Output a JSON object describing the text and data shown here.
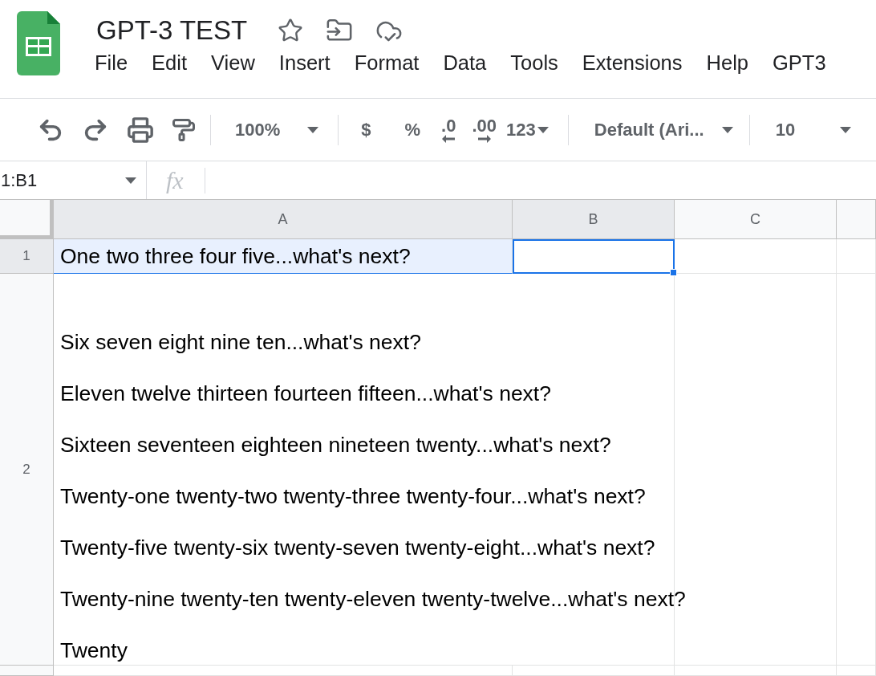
{
  "document": {
    "title": "GPT-3 TEST",
    "menu": [
      "File",
      "Edit",
      "View",
      "Insert",
      "Format",
      "Data",
      "Tools",
      "Extensions",
      "Help",
      "GPT3"
    ]
  },
  "toolbar": {
    "zoom": "100%",
    "currency": "$",
    "percent": "%",
    "decrease_decimal": ".0",
    "increase_decimal": ".00",
    "number_format": "123",
    "font": "Default (Ari...",
    "font_size": "10"
  },
  "formula_bar": {
    "name_box": "1:B1",
    "function_label": "fx"
  },
  "sheet": {
    "columns": [
      {
        "label": "A",
        "selected": true
      },
      {
        "label": "B",
        "selected": true
      },
      {
        "label": "C",
        "selected": false
      },
      {
        "selected": false
      }
    ],
    "rows": [
      {
        "number": "1",
        "selected": true,
        "cells": [
          {
            "lines": [
              "One two three four five...what's next?"
            ],
            "selected": true,
            "active": false
          },
          {
            "selected": true,
            "active": true
          },
          {
            "selected": false,
            "active": false
          },
          {
            "selected": false,
            "active": false
          }
        ]
      },
      {
        "number": "2",
        "selected": false,
        "cells": [
          {
            "lines": [
              "Six seven eight nine ten...what's next?",
              "Eleven twelve thirteen fourteen fifteen...what's next?",
              "Sixteen seventeen eighteen nineteen twenty...what's next?",
              "Twenty-one twenty-two twenty-three twenty-four...what's next?",
              "Twenty-five twenty-six twenty-seven twenty-eight...what's next?",
              "Twenty-nine twenty-ten twenty-eleven twenty-twelve...what's next?",
              "Twenty"
            ],
            "selected": false,
            "active": false
          },
          {
            "selected": false,
            "active": false
          },
          {
            "selected": false,
            "active": false
          }
        ]
      },
      {
        "selected": false,
        "cells": [
          {
            "selected": false,
            "active": false
          },
          {
            "selected": false,
            "active": false
          },
          {
            "selected": false,
            "active": false
          },
          {
            "selected": false,
            "active": false
          }
        ]
      }
    ]
  }
}
